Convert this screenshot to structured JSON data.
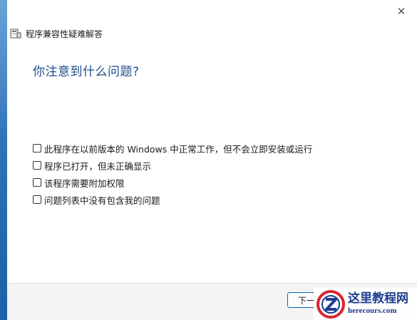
{
  "window": {
    "title": "程序兼容性疑难解答"
  },
  "main": {
    "heading": "你注意到什么问题?",
    "options": [
      {
        "label": "此程序在以前版本的 Windows 中正常工作，但不会立即安装或运行",
        "checked": false
      },
      {
        "label": "程序已打开，但未正确显示",
        "checked": false
      },
      {
        "label": "该程序需要附加权限",
        "checked": false
      },
      {
        "label": "问题列表中没有包含我的问题",
        "checked": false
      }
    ]
  },
  "footer": {
    "next_label": "下一"
  },
  "watermark": {
    "title": "这里教程网",
    "url": "herecours.com"
  },
  "colors": {
    "heading": "#1f4e8c",
    "accent_border": "#0067c0",
    "watermark": "#1e3d8f",
    "watermark_logo_red": "#d8262e"
  },
  "icons": {
    "close": "close-icon",
    "app": "troubleshooter-app-icon",
    "watermark_logo": "z-logo-icon"
  }
}
